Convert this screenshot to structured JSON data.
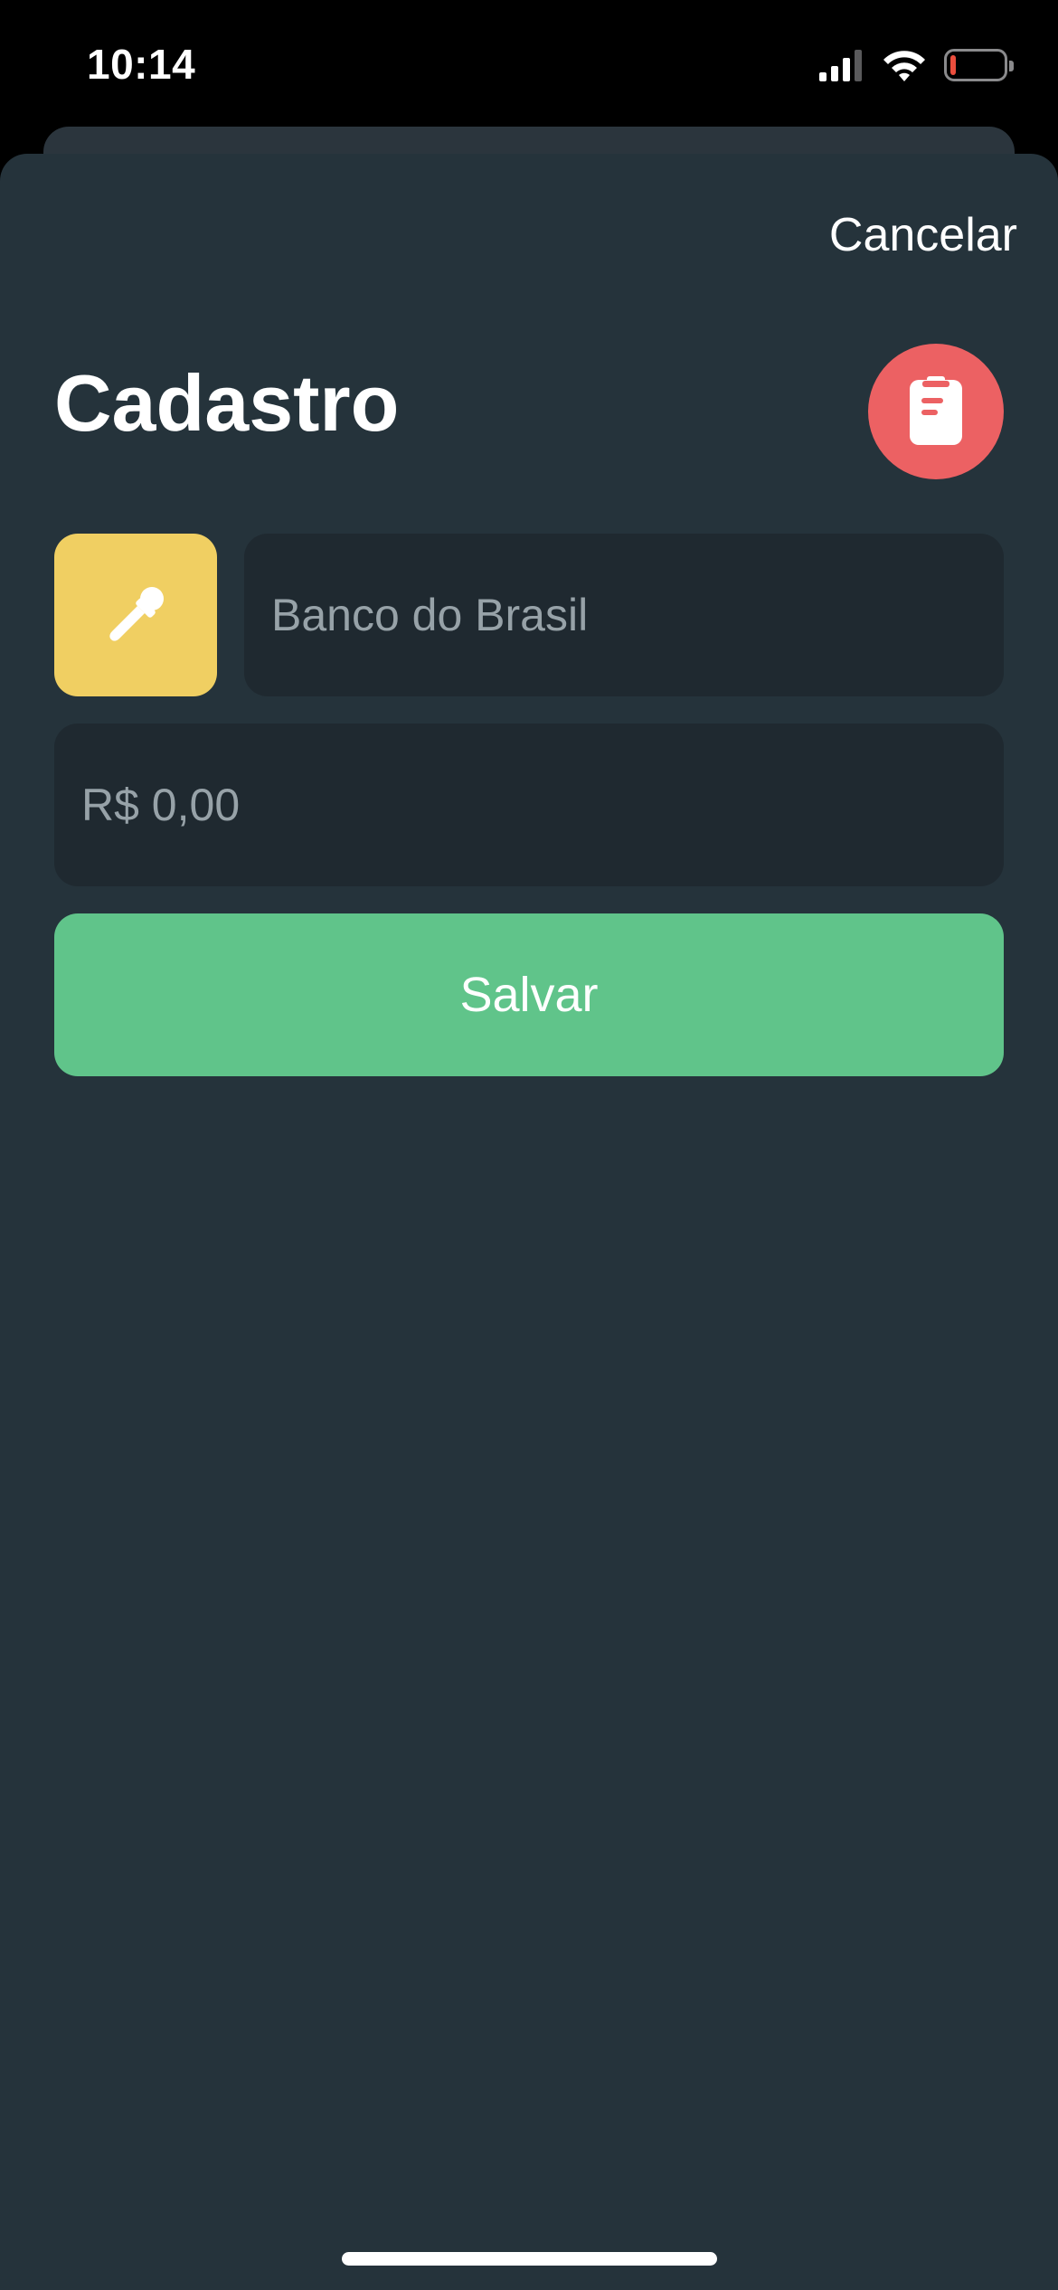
{
  "status_bar": {
    "time": "10:14",
    "signal_icon": "cellular-signal-icon",
    "wifi_icon": "wifi-icon",
    "battery_icon": "battery-low-icon",
    "battery_level": 0.1
  },
  "header": {
    "cancel_label": "Cancelar",
    "title": "Cadastro",
    "action_icon": "clipboard-icon"
  },
  "form": {
    "color_picker_icon": "eyedropper-icon",
    "name_placeholder": "Banco do Brasil",
    "name_value": "",
    "amount_placeholder": "R$ 0,00",
    "amount_value": "",
    "save_label": "Salvar"
  },
  "colors": {
    "background": "#25333b",
    "input_background": "#1f2930",
    "accent_red": "#ec6163",
    "accent_yellow": "#f0cf62",
    "accent_green": "#60c48a"
  }
}
